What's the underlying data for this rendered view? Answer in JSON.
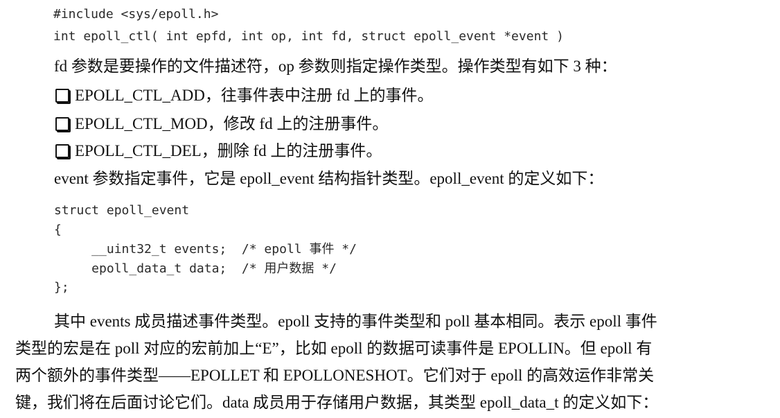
{
  "code_block_1": {
    "line1": "#include <sys/epoll.h>",
    "line2": "int epoll_ctl( int epfd, int op, int fd, struct epoll_event *event )"
  },
  "para1": "fd 参数是要操作的文件描述符，op 参数则指定操作类型。操作类型有如下 3 种：",
  "bullets": [
    {
      "icon": "checkbox-icon",
      "text": "EPOLL_CTL_ADD，往事件表中注册 fd 上的事件。"
    },
    {
      "icon": "checkbox-icon",
      "text": "EPOLL_CTL_MOD，修改 fd 上的注册事件。"
    },
    {
      "icon": "checkbox-icon",
      "text": "EPOLL_CTL_DEL，删除 fd 上的注册事件。"
    }
  ],
  "para2": "event 参数指定事件，它是 epoll_event 结构指针类型。epoll_event 的定义如下：",
  "code_block_2": {
    "line1": "struct epoll_event",
    "line2": "{",
    "line3": "     __uint32_t events;  /* epoll 事件 */",
    "line4": "     epoll_data_t data;  /* 用户数据 */",
    "line5": "};"
  },
  "para3": {
    "line1": "其中 events 成员描述事件类型。epoll 支持的事件类型和 poll 基本相同。表示 epoll 事件",
    "line2": "类型的宏是在 poll 对应的宏前加上“E”，比如 epoll 的数据可读事件是 EPOLLIN。但 epoll 有",
    "line3": "两个额外的事件类型——EPOLLET 和 EPOLLONESHOT。它们对于 epoll 的高效运作非常关",
    "line4": "键，我们将在后面讨论它们。data 成员用于存储用户数据，其类型 epoll_data_t 的定义如下："
  }
}
